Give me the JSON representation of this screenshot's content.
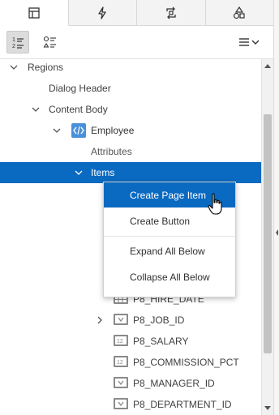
{
  "tabs": [
    {
      "icon": "layout-icon",
      "active": true
    },
    {
      "icon": "lightning-icon",
      "active": false
    },
    {
      "icon": "process-swap-icon",
      "active": false
    },
    {
      "icon": "shapes-icon",
      "active": false
    }
  ],
  "toolbar": {
    "left_buttons": [
      "numbered-list-icon",
      "tree-list-icon"
    ],
    "right_button": "menu-dropdown-icon"
  },
  "tree": {
    "regions": "Regions",
    "dialog_header": "Dialog Header",
    "content_body": "Content Body",
    "employee": "Employee",
    "attributes": "Attributes",
    "items": "Items",
    "items_list": [
      "P8_HIRE_DATE",
      "P8_JOB_ID",
      "P8_SALARY",
      "P8_COMMISSION_PCT",
      "P8_MANAGER_ID",
      "P8_DEPARTMENT_ID"
    ]
  },
  "context_menu": {
    "create_page_item": "Create Page Item",
    "create_button": "Create Button",
    "expand_all_below": "Expand All Below",
    "collapse_all_below": "Collapse All Below"
  },
  "colors": {
    "selection": "#0a69c1",
    "item_icon": "#8a8a8a",
    "region_icon": "#4a90d9"
  }
}
